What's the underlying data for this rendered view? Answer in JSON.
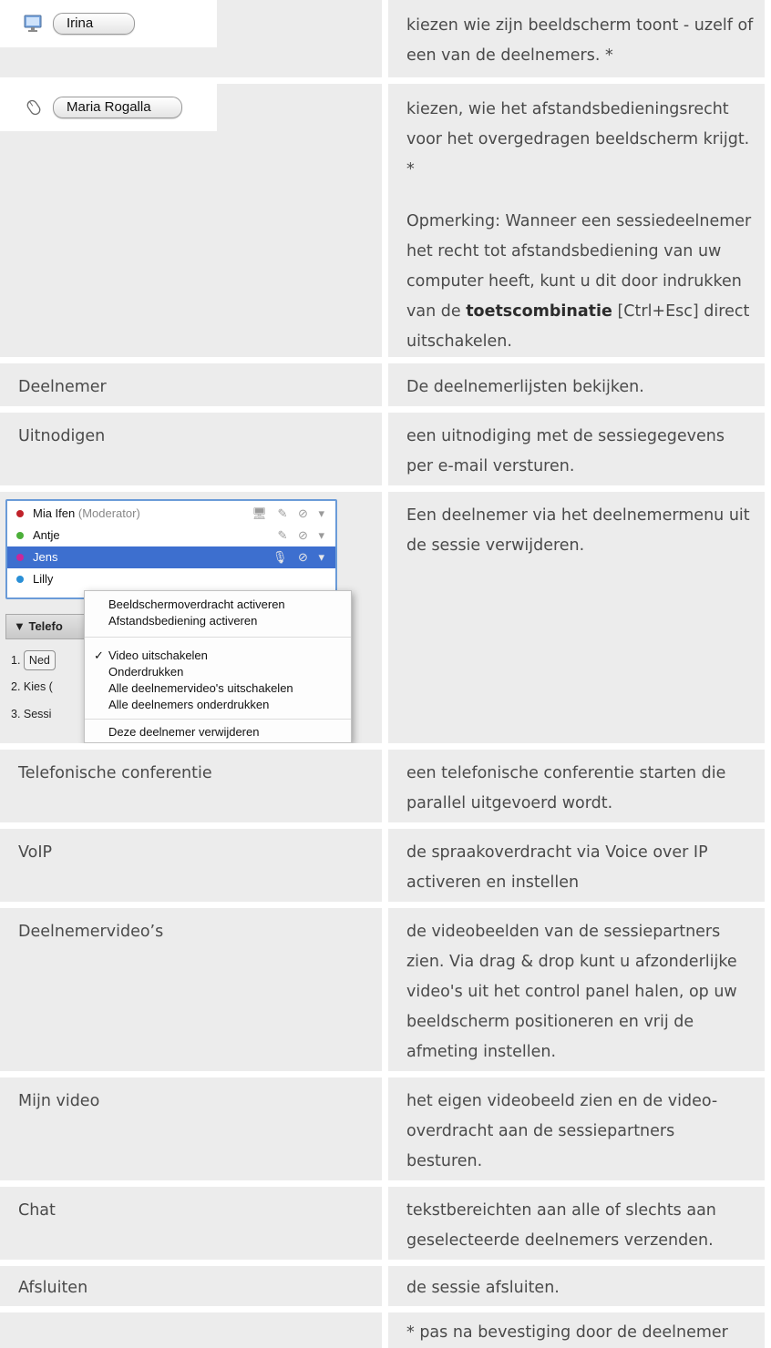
{
  "rows": [
    {
      "label": "",
      "widget": {
        "type": "screen",
        "field_value": "Irina",
        "icon": "monitor-icon"
      },
      "description": [
        "kiezen wie zijn beeldscherm toont - uzelf of een van de deelnemers. *"
      ]
    },
    {
      "label": "",
      "widget": {
        "type": "remote",
        "field_value": "Maria Rogalla",
        "icon": "mouse-icon"
      },
      "description_lines": [
        "kiezen, wie het afstandsbedieningsrecht voor het overgedragen beeldscherm krijgt. *"
      ],
      "note_before": "Opmerking: Wanneer een sessiedeelnemer het recht tot afstandsbediening van uw computer heeft, kunt u dit door indrukken van de",
      "note_emphasis": "toetscombinatie",
      "note_after": "[Ctrl+Esc] direct uitschakelen."
    },
    {
      "label": "Deelnemer",
      "description": [
        "De deelnemerlijsten bekijken."
      ]
    },
    {
      "label": "Uitnodigen",
      "description": [
        "een uitnodiging met de sessiegegevens per e-mail versturen."
      ]
    },
    {
      "label": "",
      "panel": true,
      "description": [
        "Een deelnemer via het deelnemermenu uit de sessie verwijderen."
      ]
    },
    {
      "label": "Telefonische conferentie",
      "description": [
        "een telefonische conferentie starten die parallel uitgevoerd wordt."
      ]
    },
    {
      "label": "VoIP",
      "description": [
        "de spraakoverdracht via Voice over IP activeren en instellen"
      ]
    },
    {
      "label": "Deelnemervideo’s",
      "description": [
        "de videobeelden van de sessiepartners zien. Via drag & drop kunt u afzonderlijke video's uit het control panel halen, op uw beeldscherm positioneren en vrij de afmeting instellen."
      ]
    },
    {
      "label": "Mijn video",
      "description": [
        "het eigen videobeeld zien en de video-overdracht aan de sessiepartners besturen."
      ]
    },
    {
      "label": "Chat",
      "description": [
        "tekstbereichten aan alle of slechts aan geselecteerde deelnemers verzenden."
      ]
    },
    {
      "label": "Afsluiten",
      "description": [
        "de sessie afsluiten."
      ]
    },
    {
      "label": "",
      "description": [
        "* pas na bevestiging door de deelnemer"
      ]
    }
  ],
  "panel": {
    "participants": [
      {
        "name": "Mia Ifen",
        "role": "(Moderator)",
        "dot_color": "#c0222a",
        "selected": false
      },
      {
        "name": "Antje",
        "role": "",
        "dot_color": "#4caf3a",
        "selected": false
      },
      {
        "name": "Jens",
        "role": "",
        "dot_color": "#c9279a",
        "selected": true
      },
      {
        "name": "Lilly",
        "role": "",
        "dot_color": "#2a8fd6",
        "selected": false
      }
    ],
    "section_header": "▼ Telefo",
    "background_lines": [
      "1.",
      "Ned",
      "2. Kies (",
      "3. Sessi"
    ],
    "menu_items": [
      "Beeldschermoverdracht activeren",
      "Afstandsbediening activeren",
      "Video uitschakelen",
      "Onderdrukken",
      "Alle deelnemervideo's uitschakelen",
      "Alle deelnemers onderdrukken",
      "Deze deelnemer verwijderen"
    ],
    "checked_item": "✓"
  },
  "colors": {
    "cell_background": "#ececec",
    "text": "#4a4a4a",
    "selection": "#3d6fcf"
  }
}
